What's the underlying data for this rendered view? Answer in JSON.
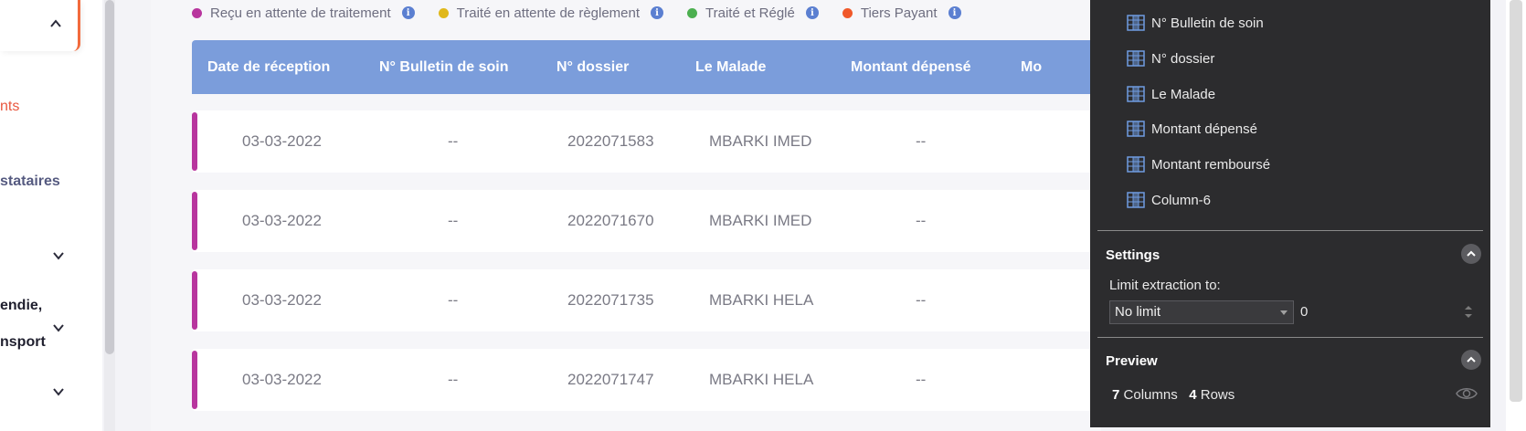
{
  "sidebar": {
    "items": [
      {
        "label": "nts",
        "color": "#e9573f"
      },
      {
        "label": "stataires",
        "color": "#555a80"
      },
      {
        "label": "endie,",
        "color": "#1f1f2e"
      },
      {
        "label": "nsport",
        "color": "#1f1f2e"
      }
    ]
  },
  "legend": [
    {
      "label": "Reçu en attente de traitement",
      "color": "#b8359e"
    },
    {
      "label": "Traité en attente de règlement",
      "color": "#e0b81b"
    },
    {
      "label": "Traité et Réglé",
      "color": "#4caf50"
    },
    {
      "label": "Tiers Payant",
      "color": "#f0582a"
    }
  ],
  "table": {
    "headers": [
      "Date de réception",
      "N° Bulletin de soin",
      "N° dossier",
      "Le Malade",
      "Montant dépensé",
      "Mo"
    ],
    "rows": [
      {
        "date": "03-03-2022",
        "bulletin": "--",
        "dossier": "2022071583",
        "malade": "MBARKI IMED",
        "montant": "--"
      },
      {
        "date": "03-03-2022",
        "bulletin": "--",
        "dossier": "2022071670",
        "malade": "MBARKI IMED",
        "montant": "--"
      },
      {
        "date": "03-03-2022",
        "bulletin": "--",
        "dossier": "2022071735",
        "malade": "MBARKI HELA",
        "montant": "--"
      },
      {
        "date": "03-03-2022",
        "bulletin": "--",
        "dossier": "2022071747",
        "malade": "MBARKI HELA",
        "montant": "--"
      }
    ],
    "row_marker_color": "#b8359e"
  },
  "panel": {
    "columns": [
      "N° Bulletin de soin",
      "N° dossier",
      "Le Malade",
      "Montant dépensé",
      "Montant remboursé",
      "Column-6"
    ],
    "settings_title": "Settings",
    "limit_label": "Limit extraction to:",
    "limit_select": "No limit",
    "limit_value": "0",
    "preview_title": "Preview",
    "preview_columns_count": "7",
    "preview_columns_word": "Columns",
    "preview_rows_count": "4",
    "preview_rows_word": "Rows"
  }
}
